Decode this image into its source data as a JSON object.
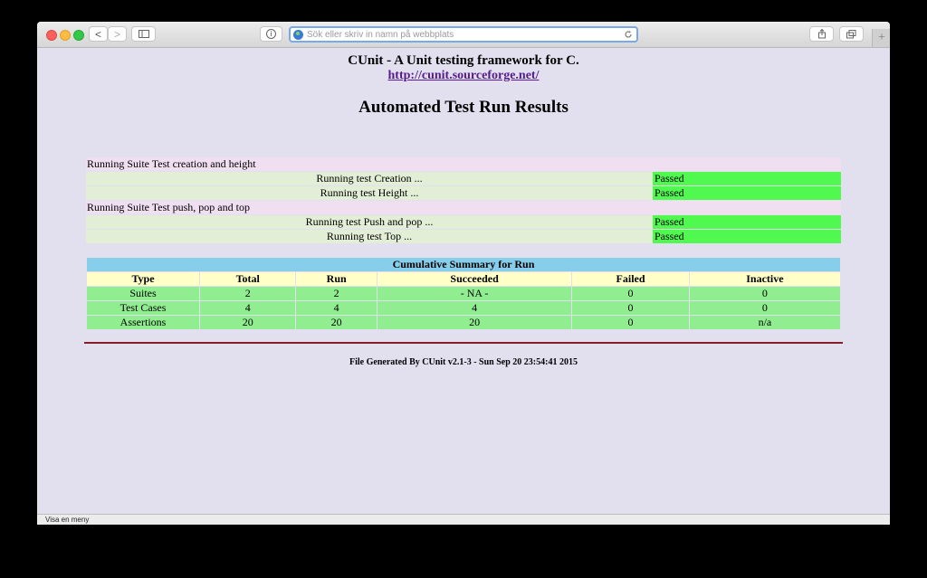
{
  "browser": {
    "url_placeholder": "Sök eller skriv in namn på webbplats",
    "status_text": "Visa en meny",
    "new_tab_label": "+",
    "info_label": "i",
    "back_label": "<",
    "forward_label": ">"
  },
  "page": {
    "header": "CUnit - A Unit testing framework for C.",
    "link": "http://cunit.sourceforge.net/",
    "title": "Automated Test Run Results"
  },
  "run": {
    "suites": [
      {
        "label": "Running Suite Test creation and height",
        "tests": [
          {
            "name": "Running test Creation ...",
            "result": "Passed"
          },
          {
            "name": "Running test Height ...",
            "result": "Passed"
          }
        ]
      },
      {
        "label": "Running Suite Test push, pop and top",
        "tests": [
          {
            "name": "Running test Push and pop ...",
            "result": "Passed"
          },
          {
            "name": "Running test Top ...",
            "result": "Passed"
          }
        ]
      }
    ]
  },
  "summary": {
    "title": "Cumulative Summary for Run",
    "headers": [
      "Type",
      "Total",
      "Run",
      "Succeeded",
      "Failed",
      "Inactive"
    ],
    "rows": [
      [
        "Suites",
        "2",
        "2",
        "- NA -",
        "0",
        "0"
      ],
      [
        "Test Cases",
        "4",
        "4",
        "4",
        "0",
        "0"
      ],
      [
        "Assertions",
        "20",
        "20",
        "20",
        "0",
        "n/a"
      ]
    ]
  },
  "footer": "File Generated By CUnit v2.1-3 - Sun Sep 20 23:54:41 2015",
  "colors": {
    "suite_row": "#f0dff0",
    "passed": "#50f850",
    "summary_title": "#87ceeb",
    "summary_header": "#ffffc8",
    "summary_body": "#90ee90",
    "page_bg": "#e2e0ef"
  }
}
